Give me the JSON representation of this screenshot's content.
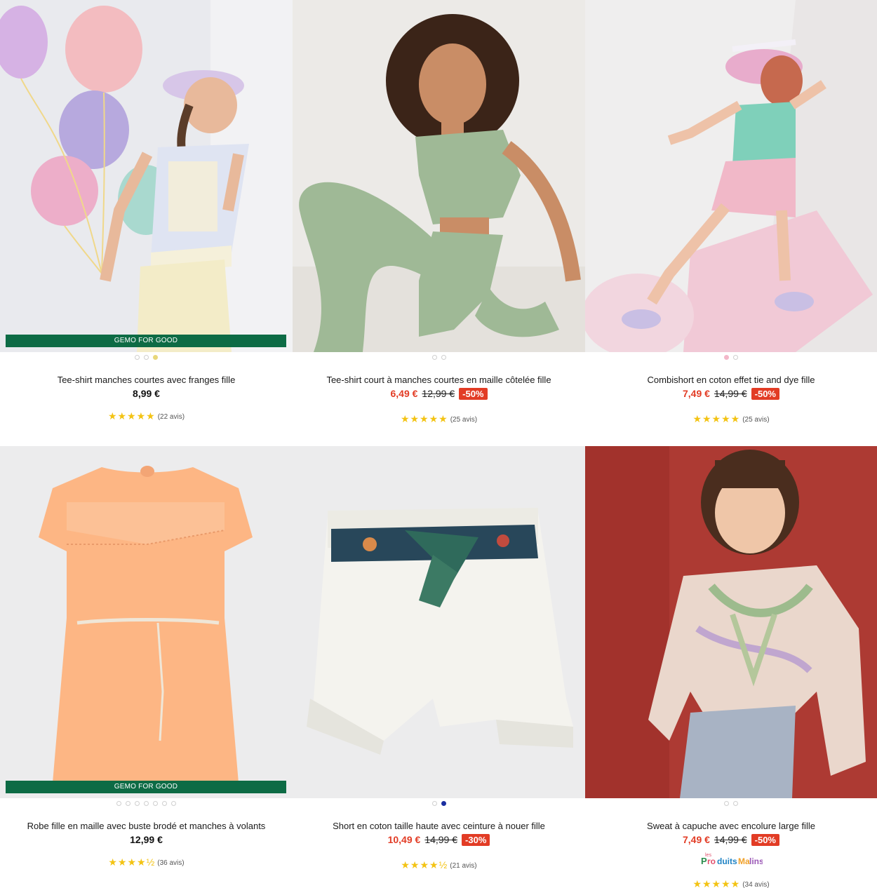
{
  "products": [
    {
      "name": "Tee-shirt manches courtes avec franges fille",
      "price": "8,99 €",
      "sale": false,
      "badge": "GEMO FOR GOOD",
      "stars": "★★★★★",
      "reviews": "(22 avis)",
      "image_dots": 3,
      "active_dot": 2
    },
    {
      "name": "Tee-shirt court à manches courtes en maille côtelée fille",
      "sale_price": "6,49 €",
      "old_price": "12,99 €",
      "discount": "-50%",
      "sale": true,
      "stars": "★★★★★",
      "reviews": "(25 avis)",
      "image_dots": 2,
      "active_dot": -1
    },
    {
      "name": "Combishort en coton effet tie and dye fille",
      "sale_price": "7,49 €",
      "old_price": "14,99 €",
      "discount": "-50%",
      "sale": true,
      "stars": "★★★★★",
      "reviews": "(25 avis)",
      "image_dots": 2,
      "active_dot": 0
    },
    {
      "name": "Robe fille en maille avec buste brodé et manches à volants",
      "price": "12,99 €",
      "sale": false,
      "badge": "GEMO FOR GOOD",
      "stars": "★★★★½",
      "reviews": "(36 avis)",
      "image_dots": 7,
      "active_dot": -1
    },
    {
      "name": "Short en coton taille haute avec ceinture à nouer fille",
      "sale_price": "10,49 €",
      "old_price": "14,99 €",
      "discount": "-30%",
      "sale": true,
      "stars": "★★★★½",
      "reviews": "(21 avis)",
      "image_dots": 2,
      "active_dot": 1
    },
    {
      "name": "Sweat à capuche avec encolure large fille",
      "sale_price": "7,49 €",
      "old_price": "14,99 €",
      "discount": "-50%",
      "sale": true,
      "brand_logo": "les Produits Malins",
      "stars": "★★★★★",
      "reviews": "(34 avis)",
      "image_dots": 2,
      "active_dot": -1
    }
  ],
  "colors": {
    "sale_red": "#e23c25",
    "badge_green": "#0d6b45",
    "star_yellow": "#f3c313"
  }
}
